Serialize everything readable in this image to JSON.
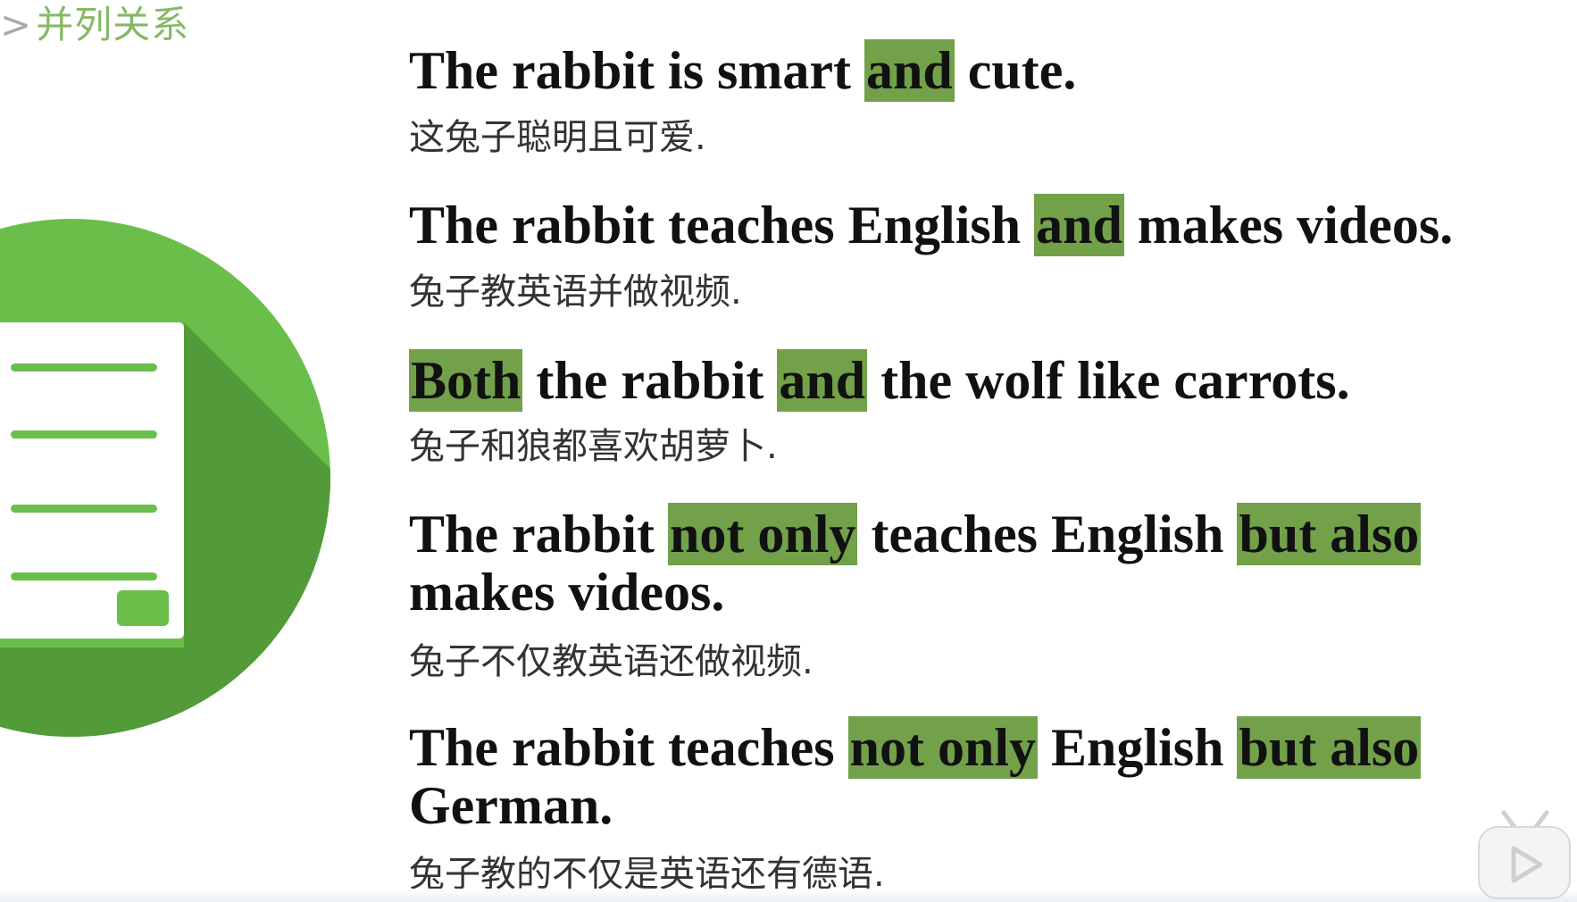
{
  "header": {
    "caret": ">",
    "title": "并列关系"
  },
  "colors": {
    "accent_green": "#86b865",
    "highlight_green": "#72a14a",
    "circle_green": "#6abf4b"
  },
  "icons": {
    "illustration": "document-list-icon",
    "player": "play-icon"
  },
  "sentences": [
    {
      "en_parts": [
        {
          "text": "The rabbit is smart ",
          "hl": false
        },
        {
          "text": "and",
          "hl": true
        },
        {
          "text": " cute.",
          "hl": false
        }
      ],
      "zh": "这兔子聪明且可爱."
    },
    {
      "en_parts": [
        {
          "text": "The rabbit teaches English ",
          "hl": false
        },
        {
          "text": "and",
          "hl": true
        },
        {
          "text": " makes videos.",
          "hl": false
        }
      ],
      "zh": "兔子教英语并做视频."
    },
    {
      "en_parts": [
        {
          "text": "Both",
          "hl": true
        },
        {
          "text": " the rabbit ",
          "hl": false
        },
        {
          "text": "and",
          "hl": true
        },
        {
          "text": " the wolf like carrots.",
          "hl": false
        }
      ],
      "zh": "兔子和狼都喜欢胡萝卜."
    },
    {
      "en_parts": [
        {
          "text": "The rabbit ",
          "hl": false
        },
        {
          "text": "not only",
          "hl": true
        },
        {
          "text": " teaches English ",
          "hl": false
        },
        {
          "text": "but also",
          "hl": true
        }
      ],
      "en_line2": "makes videos.",
      "zh": "兔子不仅教英语还做视频."
    },
    {
      "en_parts": [
        {
          "text": "The rabbit teaches ",
          "hl": false
        },
        {
          "text": "not only",
          "hl": true
        },
        {
          "text": " English ",
          "hl": false
        },
        {
          "text": "but also",
          "hl": true
        }
      ],
      "en_line2": "German.",
      "zh": "兔子教的不仅是英语还有德语."
    }
  ]
}
